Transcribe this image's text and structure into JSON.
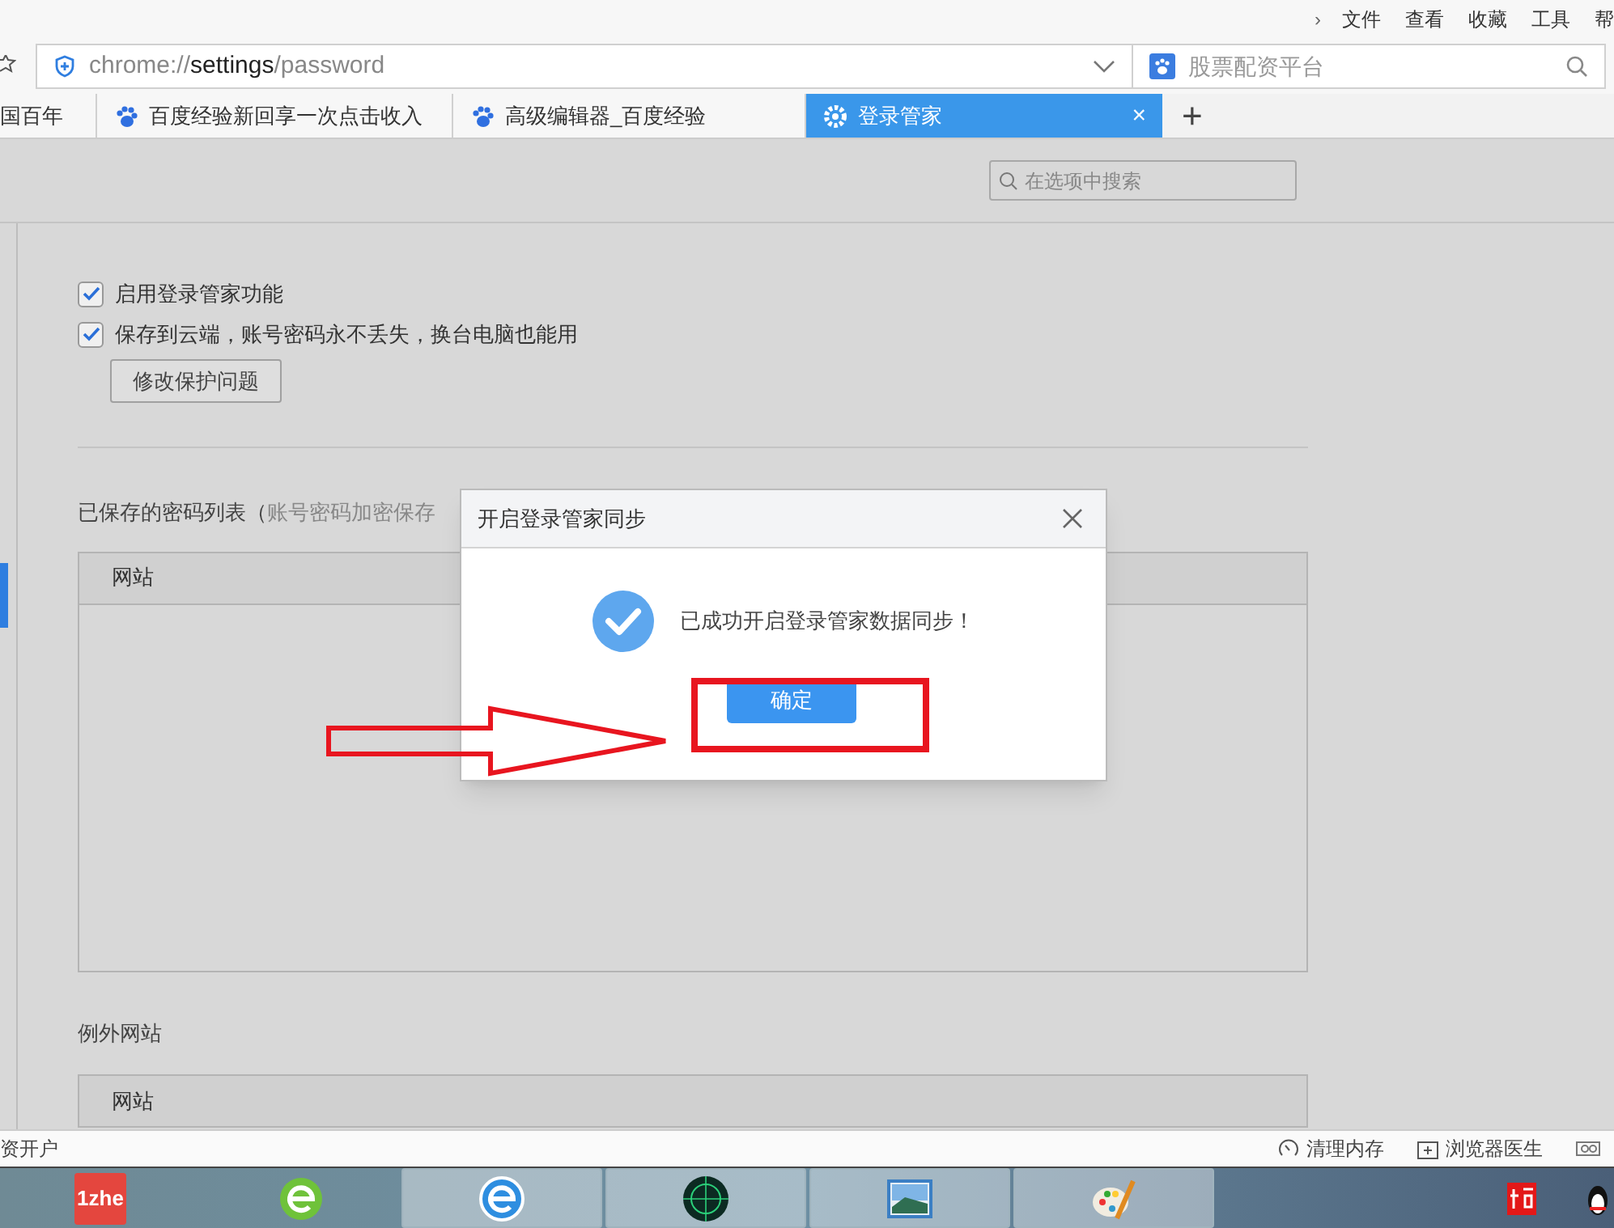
{
  "menu_bar": {
    "chevron": "›",
    "items": [
      "文件",
      "查看",
      "收藏",
      "工具",
      "帮"
    ]
  },
  "address_bar": {
    "url_parts": [
      {
        "text": "chrome://",
        "emphasis": false
      },
      {
        "text": "settings",
        "emphasis": true
      },
      {
        "text": "/password",
        "emphasis": false
      }
    ],
    "search_placeholder": "股票配资平台"
  },
  "tabs": [
    {
      "label": "国百年",
      "kind": "plain",
      "selected": false
    },
    {
      "label": "百度经验新回享一次点击收入",
      "kind": "paw",
      "selected": false
    },
    {
      "label": "高级编辑器_百度经验",
      "kind": "paw",
      "selected": false
    },
    {
      "label": "登录管家",
      "kind": "gear",
      "selected": true,
      "close": "×"
    }
  ],
  "new_tab": "+",
  "settings": {
    "search_placeholder": "在选项中搜索",
    "options": [
      {
        "label": "启用登录管家功能",
        "checked": true
      },
      {
        "label": "保存到云端，账号密码永不丢失，换台电脑也能用",
        "checked": true
      }
    ],
    "button": "修改保护问题",
    "saved_list": {
      "title": "已保存的密码列表（",
      "note": "账号密码加密保存",
      "column": "网站"
    },
    "exceptions": {
      "title": "例外网站",
      "column": "网站"
    }
  },
  "dialog": {
    "title": "开启登录管家同步",
    "message": "已成功开启登录管家数据同步！",
    "button": "确定"
  },
  "status_bar": {
    "left": "资开户",
    "items": [
      {
        "label": "清理内存",
        "kind": "gauge"
      },
      {
        "label": "浏览器医生",
        "kind": "plus"
      }
    ]
  },
  "taskbar": {
    "apps": [
      {
        "kind": "badge",
        "label": "1zhe",
        "active": false
      },
      {
        "kind": "green-e",
        "active": false
      },
      {
        "kind": "blue-e",
        "active": true
      },
      {
        "kind": "radar",
        "active": true
      },
      {
        "kind": "photo",
        "active": true
      },
      {
        "kind": "palette",
        "active": true
      }
    ]
  }
}
